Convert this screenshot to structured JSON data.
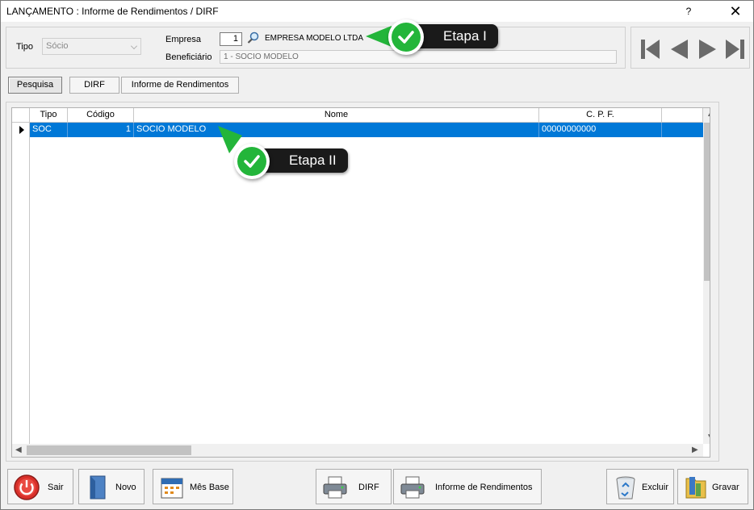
{
  "window": {
    "title": "LANÇAMENTO : Informe de Rendimentos / DIRF",
    "help_label": "?",
    "close_label": "✕"
  },
  "filters": {
    "tipo_label": "Tipo",
    "tipo_value": "Sócio",
    "empresa_label": "Empresa",
    "empresa_code": "1",
    "empresa_name": "EMPRESA MODELO LTDA",
    "beneficiario_label": "Beneficiário",
    "beneficiario_value": "1 - SOCIO MODELO"
  },
  "tabs": [
    {
      "label": "Pesquisa",
      "active": true
    },
    {
      "label": "DIRF",
      "active": false
    },
    {
      "label": "Informe de Rendimentos",
      "active": false
    }
  ],
  "grid": {
    "columns": [
      "Tipo",
      "Código",
      "Nome",
      "C. P. F."
    ],
    "rows": [
      {
        "tipo": "SOC",
        "codigo": "1",
        "nome": "SOCIO MODELO",
        "cpf": "00000000000",
        "selected": true
      }
    ]
  },
  "callouts": {
    "etapa1": "Etapa I",
    "etapa2": "Etapa II"
  },
  "buttons": {
    "sair": "Sair",
    "novo": "Novo",
    "mes_base": "Mês Base",
    "dirf": "DIRF",
    "informe": "Informe de Rendimentos",
    "excluir": "Excluir",
    "gravar": "Gravar"
  },
  "colors": {
    "selection": "#0078d7",
    "callout_bg": "#1a1a1a",
    "check_green": "#23b53a"
  }
}
